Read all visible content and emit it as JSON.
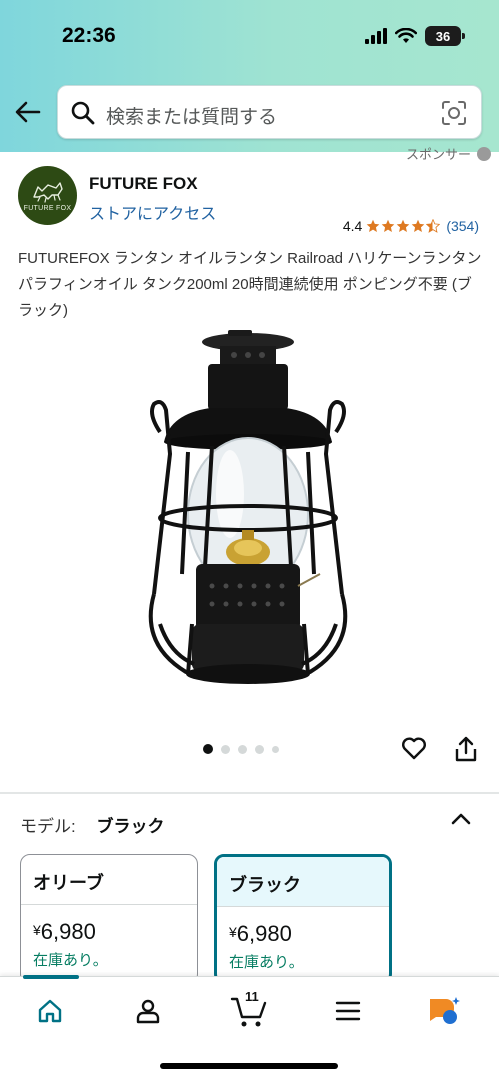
{
  "status_bar": {
    "time": "22:36",
    "battery": "36"
  },
  "search": {
    "placeholder": "検索または質問する"
  },
  "sponsor": {
    "label": "スポンサー"
  },
  "brand": {
    "name": "FUTURE FOX",
    "store_link": "ストアにアクセス",
    "logo_text": "FUTURE FOX"
  },
  "rating": {
    "value": "4.4",
    "count": "(354)",
    "stars": 4.4
  },
  "product": {
    "title": "FUTUREFOX ランタン オイルランタン Railroad ハリケーンランタン パラフィンオイル タンク200ml 20時間連続使用 ポンピング不要 (ブラック)"
  },
  "gallery": {
    "image_count": 5,
    "active_index": 0
  },
  "model": {
    "label": "モデル:",
    "selected": "ブラック",
    "options": [
      {
        "name": "オリーブ",
        "currency": "¥",
        "price": "6,980",
        "stock": "在庫あり。"
      },
      {
        "name": "ブラック",
        "currency": "¥",
        "price": "6,980",
        "stock": "在庫あり。"
      }
    ]
  },
  "nav": {
    "cart_count": "11",
    "active": "home"
  },
  "colors": {
    "accent": "#007185",
    "link": "#2162a1",
    "star": "#de7921",
    "stock": "#067d62",
    "header_start": "#7fd6dc",
    "header_end": "#a6e6cf"
  }
}
